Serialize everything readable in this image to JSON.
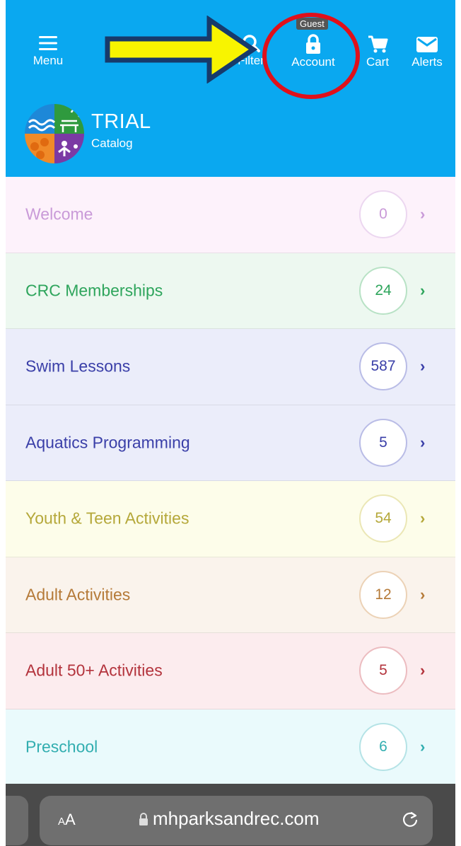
{
  "header": {
    "nav": [
      {
        "label": "Menu",
        "icon": "hamburger-icon"
      },
      {
        "label": "Filter",
        "icon": "search-icon"
      },
      {
        "label": "Account",
        "icon": "lock-icon"
      },
      {
        "label": "Cart",
        "icon": "cart-icon"
      },
      {
        "label": "Alerts",
        "icon": "mail-icon"
      }
    ],
    "guest_badge": "Guest",
    "brand_title": "TRIAL",
    "brand_subtitle": "Catalog",
    "background": "#0aa8f0"
  },
  "categories": [
    {
      "name": "Welcome",
      "count": "0",
      "color": "#c99ad8",
      "bg": "#fdf2fb",
      "border": "#ecd7f0"
    },
    {
      "name": "CRC Memberships",
      "count": "24",
      "color": "#2ea55c",
      "bg": "#edf8f0",
      "border": "#b8e2c5"
    },
    {
      "name": "Swim Lessons",
      "count": "587",
      "color": "#3a3fa8",
      "bg": "#ebedfa",
      "border": "#b9bce6"
    },
    {
      "name": "Aquatics Programming",
      "count": "5",
      "color": "#3a3fa8",
      "bg": "#ebedfa",
      "border": "#b9bce6"
    },
    {
      "name": "Youth & Teen Activities",
      "count": "54",
      "color": "#b5a83a",
      "bg": "#fdfdea",
      "border": "#ebe7b5"
    },
    {
      "name": "Adult Activities",
      "count": "12",
      "color": "#b57a38",
      "bg": "#faf3ec",
      "border": "#ecd2b6"
    },
    {
      "name": "Adult 50+ Activities",
      "count": "5",
      "color": "#b3333c",
      "bg": "#fcecee",
      "border": "#ecbcc0"
    },
    {
      "name": "Preschool",
      "count": "6",
      "color": "#32aeb0",
      "bg": "#eafafc",
      "border": "#b5e3e6"
    }
  ],
  "browser": {
    "text_size_button": "AA",
    "url": "mhparksandrec.com"
  }
}
